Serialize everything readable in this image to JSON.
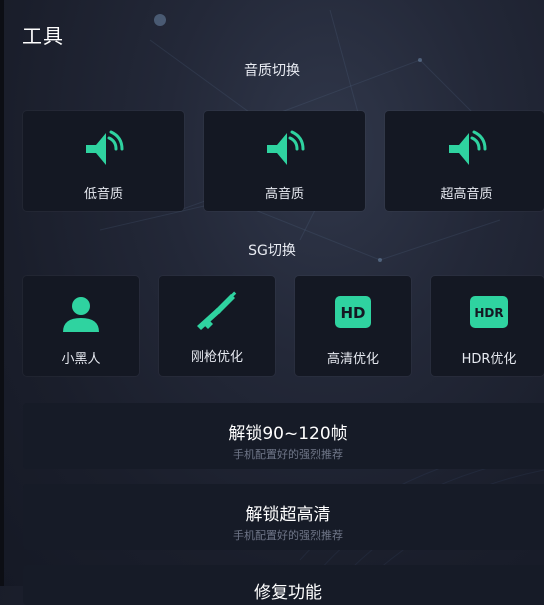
{
  "header": {
    "title": "工具"
  },
  "quality": {
    "section_label": "音质切换",
    "options": [
      {
        "label": "低音质",
        "icon": "speaker-icon"
      },
      {
        "label": "高音质",
        "icon": "speaker-icon"
      },
      {
        "label": "超高音质",
        "icon": "speaker-icon"
      }
    ]
  },
  "sg": {
    "section_label": "SG切换",
    "options": [
      {
        "label": "小黑人",
        "icon": "person-icon"
      },
      {
        "label": "刚枪优化",
        "icon": "rifle-icon"
      },
      {
        "label": "高清优化",
        "icon": "hd-badge-icon",
        "badge": "HD"
      },
      {
        "label": "HDR优化",
        "icon": "hdr-badge-icon",
        "badge": "HDR"
      }
    ]
  },
  "actions": [
    {
      "title": "解锁90~120帧",
      "subtitle": "手机配置好的强烈推荐"
    },
    {
      "title": "解锁超高清",
      "subtitle": "手机配置好的强烈推荐"
    },
    {
      "title": "修复功能"
    }
  ],
  "colors": {
    "accent_green": "#2fd3a0",
    "card_bg": "#141823"
  }
}
